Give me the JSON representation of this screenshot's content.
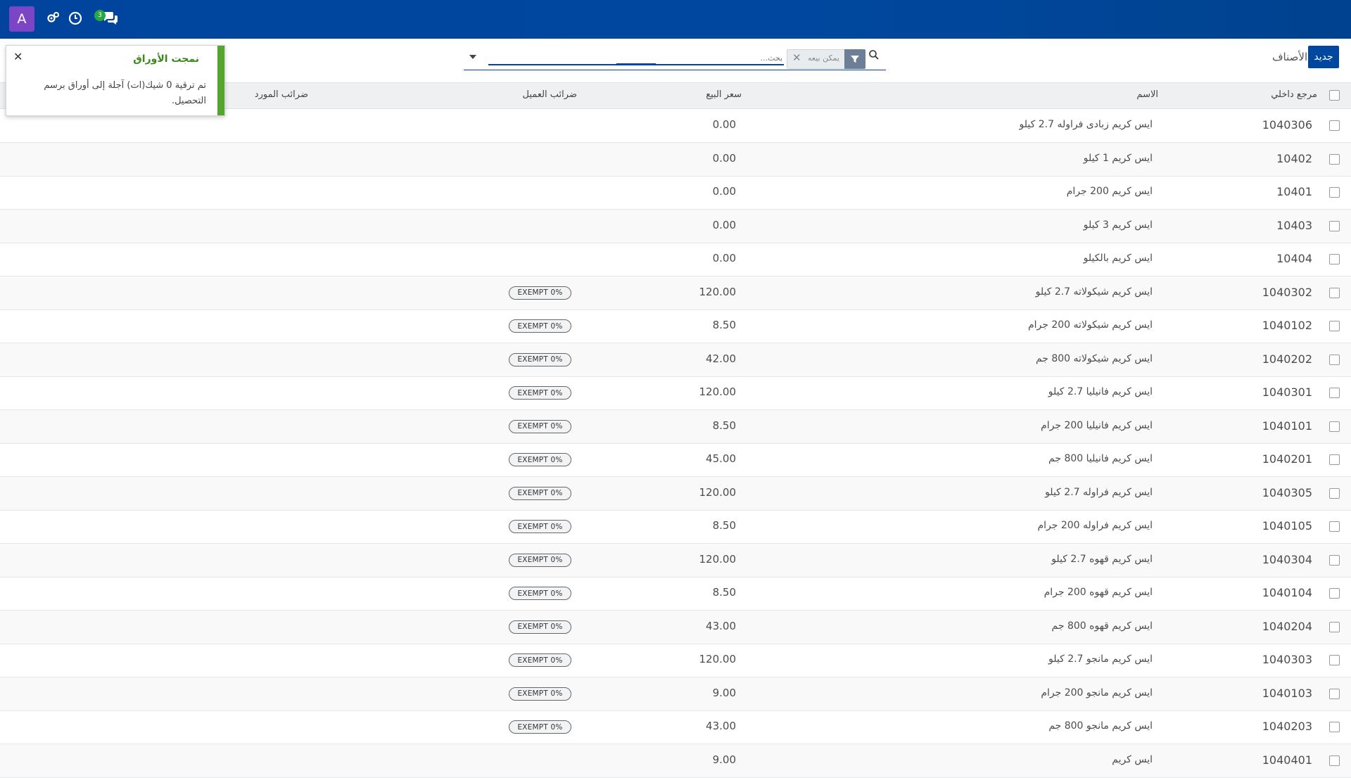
{
  "navbar": {
    "avatar_letter": "A",
    "messages_count": "3"
  },
  "control_panel": {
    "new_button": "جديد",
    "title": "الأصناف",
    "facet_label": "يمكن بيعه",
    "search_placeholder": "بحث..."
  },
  "table": {
    "headers": {
      "internal_ref": "مرجع داخلي",
      "name": "الاسم",
      "sale_price": "سعر البيع",
      "customer_taxes": "ضرائب العميل",
      "vendor_taxes": "ضرائب المورد"
    },
    "rows": [
      {
        "ref": "1040306",
        "name": "ايس كريم زبادى فراوله 2.7 كيلو",
        "price": "0.00",
        "tax": ""
      },
      {
        "ref": "10402",
        "name": "ايس كريم 1 كيلو",
        "price": "0.00",
        "tax": ""
      },
      {
        "ref": "10401",
        "name": "ايس كريم 200 جرام",
        "price": "0.00",
        "tax": ""
      },
      {
        "ref": "10403",
        "name": "ايس كريم 3 كيلو",
        "price": "0.00",
        "tax": ""
      },
      {
        "ref": "10404",
        "name": "ايس كريم بالكيلو",
        "price": "0.00",
        "tax": ""
      },
      {
        "ref": "1040302",
        "name": "ايس كريم شيكولاته 2.7 كيلو",
        "price": "120.00",
        "tax": "EXEMPT 0%"
      },
      {
        "ref": "1040102",
        "name": "ايس كريم شيكولاته 200 جرام",
        "price": "8.50",
        "tax": "EXEMPT 0%"
      },
      {
        "ref": "1040202",
        "name": "ايس كريم شيكولاته 800 جم",
        "price": "42.00",
        "tax": "EXEMPT 0%"
      },
      {
        "ref": "1040301",
        "name": "ايس كريم فانيليا 2.7 كيلو",
        "price": "120.00",
        "tax": "EXEMPT 0%"
      },
      {
        "ref": "1040101",
        "name": "ايس كريم فانيليا 200 جرام",
        "price": "8.50",
        "tax": "EXEMPT 0%"
      },
      {
        "ref": "1040201",
        "name": "ايس كريم فانيليا 800 جم",
        "price": "45.00",
        "tax": "EXEMPT 0%"
      },
      {
        "ref": "1040305",
        "name": "ايس كريم فراوله 2.7 كيلو",
        "price": "120.00",
        "tax": "EXEMPT 0%"
      },
      {
        "ref": "1040105",
        "name": "ايس كريم فراوله 200 جرام",
        "price": "8.50",
        "tax": "EXEMPT 0%"
      },
      {
        "ref": "1040304",
        "name": "ايس كريم قهوه 2.7 كيلو",
        "price": "120.00",
        "tax": "EXEMPT 0%"
      },
      {
        "ref": "1040104",
        "name": "ايس كريم قهوه 200 جرام",
        "price": "8.50",
        "tax": "EXEMPT 0%"
      },
      {
        "ref": "1040204",
        "name": "ايس كريم قهوه 800 جم",
        "price": "43.00",
        "tax": "EXEMPT 0%"
      },
      {
        "ref": "1040303",
        "name": "ايس كريم مانجو 2.7 كيلو",
        "price": "120.00",
        "tax": "EXEMPT 0%"
      },
      {
        "ref": "1040103",
        "name": "ايس كريم مانجو 200 جرام",
        "price": "9.00",
        "tax": "EXEMPT 0%"
      },
      {
        "ref": "1040203",
        "name": "ايس كريم مانجو 800 جم",
        "price": "43.00",
        "tax": "EXEMPT 0%"
      },
      {
        "ref": "1040401",
        "name": "ايس كريم",
        "price": "9.00",
        "tax": ""
      }
    ]
  },
  "toast": {
    "title": "نمجت الأوراق",
    "body": "تم ترقية 0 شيك(ات) آجلة إلى أوراق برسم التحصيل."
  },
  "colors": {
    "navbar": "#00489f",
    "primary": "#00489f",
    "avatar": "#7b45c5",
    "success": "#53a52b",
    "badge": "#28a745"
  }
}
